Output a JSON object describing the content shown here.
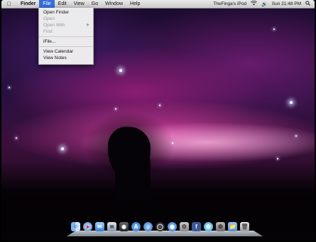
{
  "menubar": {
    "apple": "",
    "app_name": "Finder",
    "menus": [
      "File",
      "Edit",
      "View",
      "Go",
      "Window",
      "Help"
    ],
    "device_name": "TheFinga's iPod",
    "clock": "Sun 21:48 PM"
  },
  "file_menu": {
    "items": [
      {
        "label": "Open Finder",
        "enabled": true
      },
      {
        "label": "Open",
        "enabled": false
      },
      {
        "label": "Open With",
        "enabled": false,
        "submenu": true
      },
      {
        "label": "Find",
        "enabled": false
      },
      {
        "label": "iFile...",
        "enabled": true
      },
      {
        "label": "View Calendar",
        "enabled": true
      },
      {
        "label": "View Notes",
        "enabled": true
      }
    ]
  },
  "dock": {
    "icons": [
      "finder-icon",
      "safari-icon",
      "messages-icon",
      "mail-icon",
      "camera-icon",
      "app-store-icon",
      "itunes-icon",
      "dashboard-icon",
      "reddit-icon",
      "settings-icon",
      "facebook-icon",
      "twitter-icon",
      "system-preferences-icon",
      "folder-icon",
      "trash-icon"
    ]
  }
}
